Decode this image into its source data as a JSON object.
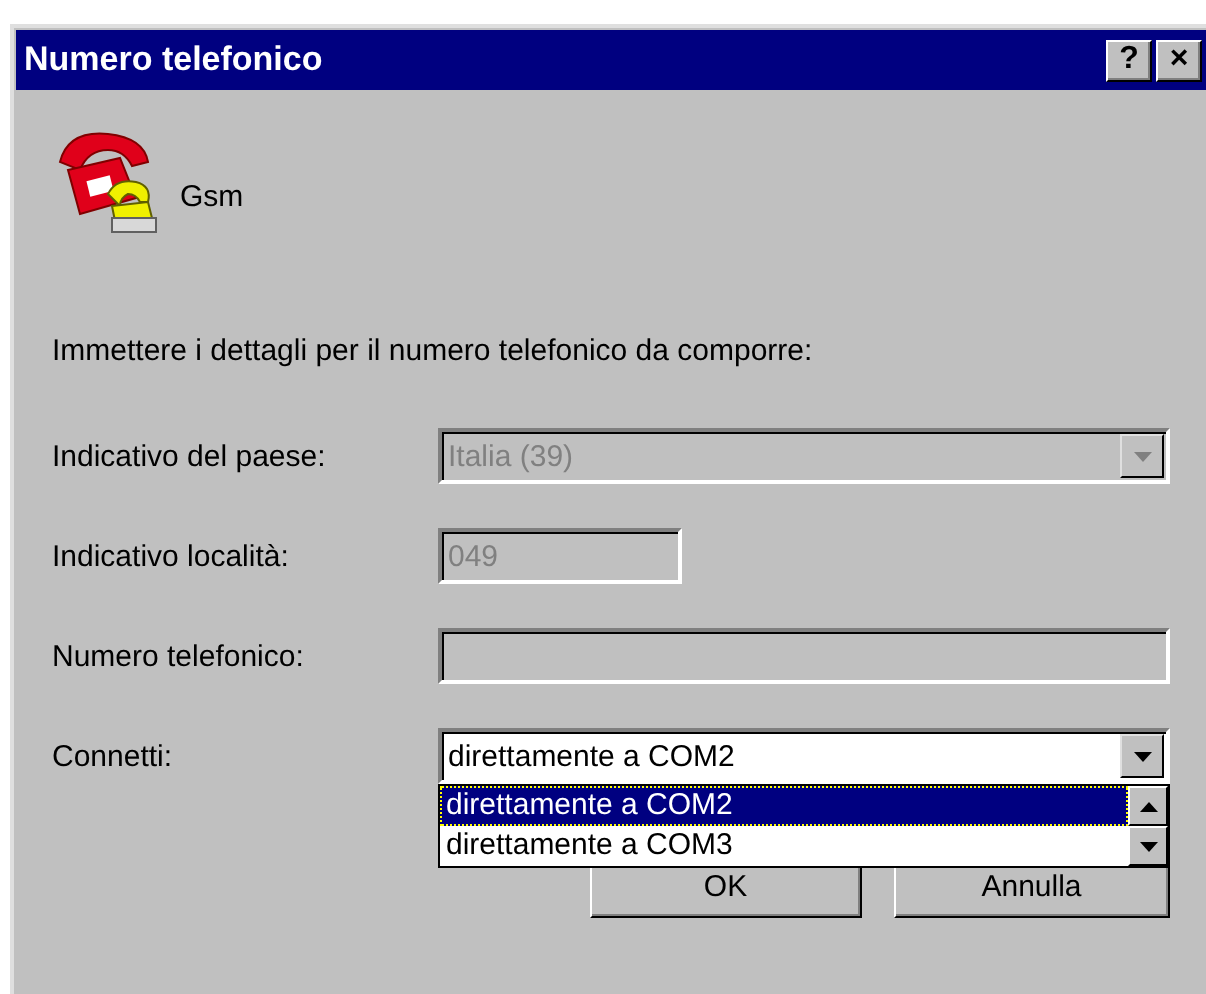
{
  "window": {
    "title": "Numero telefonico",
    "help_button": "?",
    "close_button": "×"
  },
  "connection_name": "Gsm",
  "instruction": "Immettere i dettagli per il numero telefonico da comporre:",
  "fields": [
    {
      "kind": "combo",
      "label": "Indicativo del paese:",
      "value": "Italia (39)",
      "disabled": true
    },
    {
      "kind": "short",
      "label": "Indicativo località:",
      "value": "049",
      "disabled": true
    },
    {
      "kind": "text",
      "label": "Numero telefonico:",
      "disabled": true
    },
    {
      "kind": "combo",
      "label": "Connetti:",
      "value": "direttamente a COM2",
      "disabled": false,
      "expanded": true,
      "options": [
        {
          "label": "direttamente a COM2",
          "selected": true
        },
        {
          "label": "direttamente a COM3",
          "selected": false
        }
      ]
    }
  ],
  "buttons": [
    "OK",
    "Annulla"
  ]
}
